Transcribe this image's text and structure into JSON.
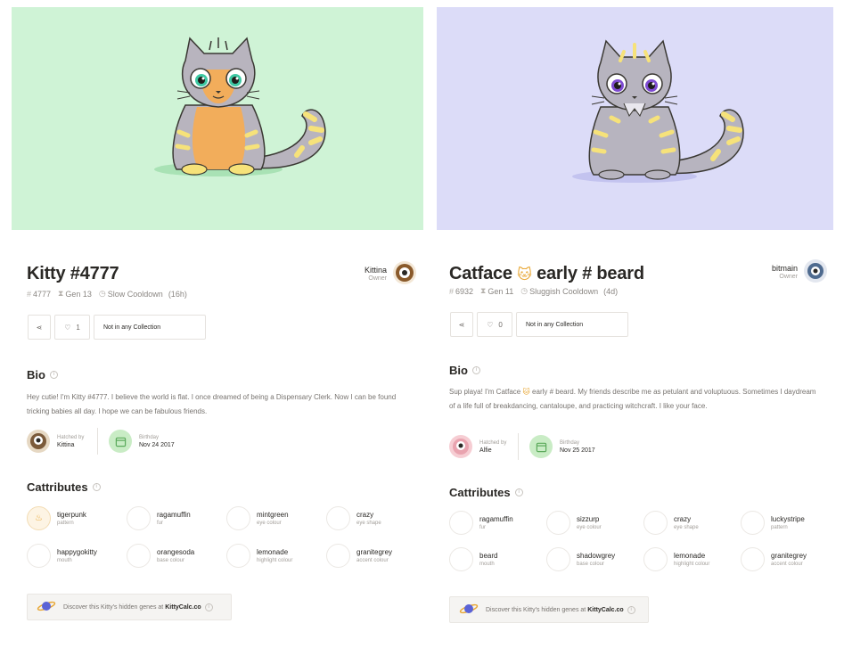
{
  "colors": {
    "left_hero_bg": "#cff3d6",
    "right_hero_bg": "#dcdcf8",
    "left_fur": "#f2ad5b",
    "right_fur": "#b7b4bf",
    "tail_stripe": "#f6e27a"
  },
  "left": {
    "title": "Kitty #4777",
    "meta": {
      "id": "4777",
      "gen": "Gen 13",
      "cooldown": "Slow Cooldown",
      "cooldown_time": "(16h)"
    },
    "owner": {
      "name": "Kittina",
      "role": "Owner"
    },
    "actions": {
      "likes": "1",
      "collection": "Not in any Collection"
    },
    "bio_heading": "Bio",
    "bio_text": "Hey cutie! I'm Kitty #4777. I believe the world is flat. I once dreamed of being a Dispensary Clerk. Now I can be found tricking babies all day. I hope we can be fabulous friends.",
    "hatched_label": "Hatched by",
    "hatched_by": "Kittina",
    "birthday_label": "Birthday",
    "birthday": "Nov 24 2017",
    "cattributes_heading": "Cattributes",
    "cattributes": [
      {
        "name": "tigerpunk",
        "type": "pattern"
      },
      {
        "name": "ragamuffin",
        "type": "fur"
      },
      {
        "name": "mintgreen",
        "type": "eye colour"
      },
      {
        "name": "crazy",
        "type": "eye shape"
      },
      {
        "name": "happygokitty",
        "type": "mouth"
      },
      {
        "name": "orangesoda",
        "type": "base colour"
      },
      {
        "name": "lemonade",
        "type": "highlight colour"
      },
      {
        "name": "granitegrey",
        "type": "accent colour"
      }
    ],
    "discover": {
      "text": "Discover this Kitty's hidden genes at",
      "link": "KittyCalc.co"
    }
  },
  "right": {
    "title_a": "Catface",
    "title_emoji": "🐱",
    "title_b": "early # beard",
    "meta": {
      "id": "6932",
      "gen": "Gen 11",
      "cooldown": "Sluggish Cooldown",
      "cooldown_time": "(4d)"
    },
    "owner": {
      "name": "bitmain",
      "role": "Owner"
    },
    "actions": {
      "likes": "0",
      "collection": "Not in any Collection"
    },
    "bio_heading": "Bio",
    "bio_a": "Sup playa! I'm Catface",
    "bio_emoji": "🐱",
    "bio_b": "early # beard. My friends describe me as petulant and voluptuous. Sometimes I daydream of a life full of breakdancing, cantaloupe, and practicing witchcraft. I like your face.",
    "hatched_label": "Hatched by",
    "hatched_by": "Alfie",
    "birthday_label": "Birthday",
    "birthday": "Nov 25 2017",
    "cattributes_heading": "Cattributes",
    "cattributes": [
      {
        "name": "ragamuffin",
        "type": "fur"
      },
      {
        "name": "sizzurp",
        "type": "eye colour"
      },
      {
        "name": "crazy",
        "type": "eye shape"
      },
      {
        "name": "luckystripe",
        "type": "pattern"
      },
      {
        "name": "beard",
        "type": "mouth"
      },
      {
        "name": "shadowgrey",
        "type": "base colour"
      },
      {
        "name": "lemonade",
        "type": "highlight colour"
      },
      {
        "name": "granitegrey",
        "type": "accent colour"
      }
    ],
    "discover": {
      "text": "Discover this Kitty's hidden genes at",
      "link": "KittyCalc.co"
    }
  }
}
